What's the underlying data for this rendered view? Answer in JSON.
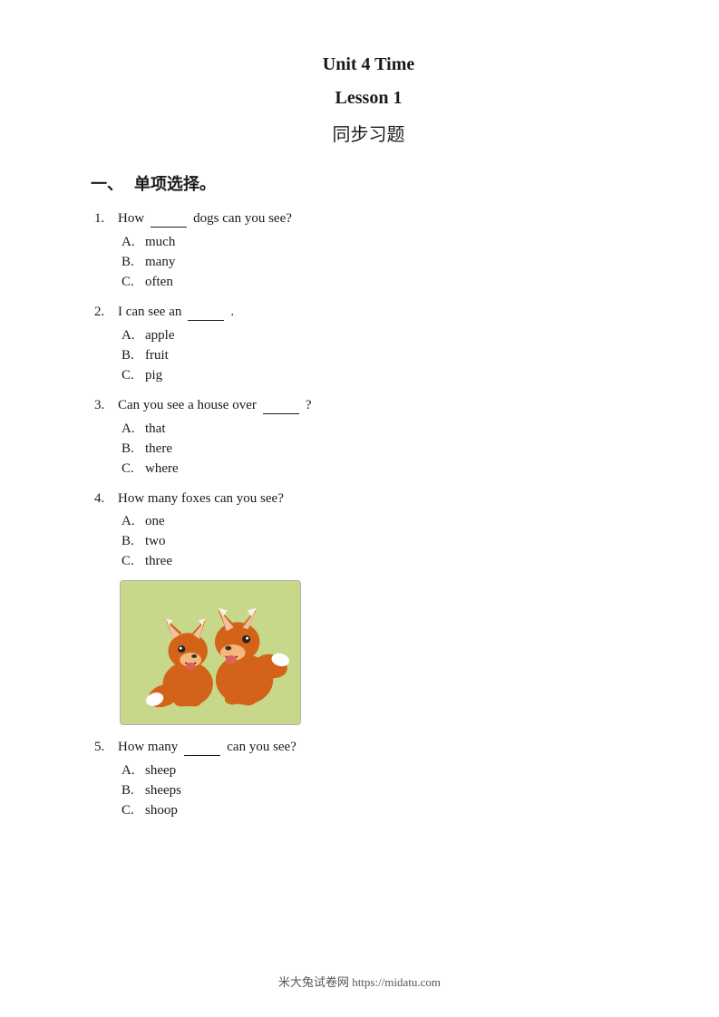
{
  "header": {
    "unit_title": "Unit 4 Time",
    "lesson_title": "Lesson 1",
    "subtitle": "同步习题"
  },
  "section1": {
    "label": "一、",
    "title": "单项选择。"
  },
  "questions": [
    {
      "number": "1.",
      "text_before": "How",
      "blank": true,
      "text_after": "dogs can you see?",
      "options": [
        {
          "label": "A.",
          "text": "much"
        },
        {
          "label": "B.",
          "text": "many"
        },
        {
          "label": "C.",
          "text": "often"
        }
      ]
    },
    {
      "number": "2.",
      "text_before": "I can see an",
      "blank": true,
      "text_after": ".",
      "options": [
        {
          "label": "A.",
          "text": "apple"
        },
        {
          "label": "B.",
          "text": "fruit"
        },
        {
          "label": "C.",
          "text": "pig"
        }
      ]
    },
    {
      "number": "3.",
      "text_before": "Can you see a house over",
      "blank": true,
      "text_after": "?",
      "options": [
        {
          "label": "A.",
          "text": "that"
        },
        {
          "label": "B.",
          "text": "there"
        },
        {
          "label": "C.",
          "text": "where"
        }
      ]
    },
    {
      "number": "4.",
      "text_before": "How many foxes can you see?",
      "blank": false,
      "text_after": "",
      "options": [
        {
          "label": "A.",
          "text": "one"
        },
        {
          "label": "B.",
          "text": "two"
        },
        {
          "label": "C.",
          "text": "three"
        }
      ],
      "has_image": true
    },
    {
      "number": "5.",
      "text_before": "How many",
      "blank": true,
      "text_after": "can you see?",
      "options": [
        {
          "label": "A.",
          "text": "sheep"
        },
        {
          "label": "B.",
          "text": "sheeps"
        },
        {
          "label": "C.",
          "text": "shoop"
        }
      ]
    }
  ],
  "footer": {
    "text": "米大兔试卷网 https://midatu.com"
  }
}
